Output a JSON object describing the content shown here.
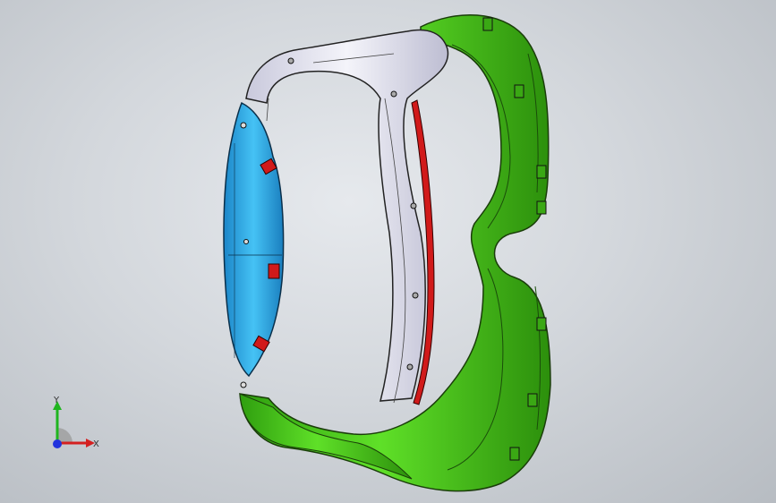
{
  "triad": {
    "x_label": "X",
    "y_label": "Y"
  },
  "colors": {
    "background_center": "#e6e9ed",
    "background_edge": "#b7bcc2",
    "green_part": "#4fd11e",
    "blue_part": "#2aa9e6",
    "white_part": "#e8e8f2",
    "red_part": "#d11a1a",
    "edge_line": "#1a1a1a",
    "x_axis": "#d42020",
    "y_axis": "#1fb51f",
    "z_axis": "#2233dd"
  },
  "model": {
    "parts": [
      "green-frame-part",
      "blue-bracket-part",
      "white-frame-part",
      "red-strip-part"
    ]
  }
}
